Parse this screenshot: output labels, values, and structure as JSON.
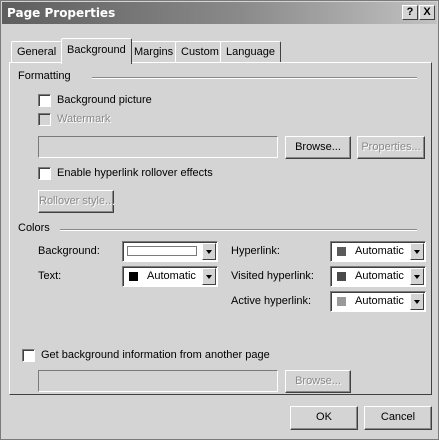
{
  "window": {
    "title": "Page Properties",
    "help_label": "?",
    "close_label": "X"
  },
  "tabs": [
    {
      "label": "General",
      "active": false
    },
    {
      "label": "Background",
      "active": true
    },
    {
      "label": "Margins",
      "active": false
    },
    {
      "label": "Custom",
      "active": false
    },
    {
      "label": "Language",
      "active": false
    }
  ],
  "formatting": {
    "group_label": "Formatting",
    "background_picture": {
      "label": "Background picture",
      "checked": false
    },
    "watermark": {
      "label": "Watermark",
      "checked": false,
      "enabled": false
    },
    "picture_path": "",
    "browse_label": "Browse...",
    "properties_label": "Properties...",
    "rollover": {
      "label": "Enable hyperlink rollover effects",
      "checked": false
    },
    "rollover_style_label": "Rollover style..."
  },
  "colors": {
    "group_label": "Colors",
    "background": {
      "label": "Background:",
      "value": "",
      "swatch": "#ffffff"
    },
    "text": {
      "label": "Text:",
      "value": "Automatic",
      "swatch": "#000000"
    },
    "hyperlink": {
      "label": "Hyperlink:",
      "value": "Automatic",
      "swatch": "#5a5a5a"
    },
    "visited_hyperlink": {
      "label": "Visited hyperlink:",
      "value": "Automatic",
      "swatch": "#4a4a4a"
    },
    "active_hyperlink": {
      "label": "Active hyperlink:",
      "value": "Automatic",
      "swatch": "#9a9a9a"
    }
  },
  "other_page": {
    "label": "Get background information from another page",
    "checked": false,
    "path": "",
    "browse_label": "Browse..."
  },
  "footer": {
    "ok_label": "OK",
    "cancel_label": "Cancel"
  }
}
